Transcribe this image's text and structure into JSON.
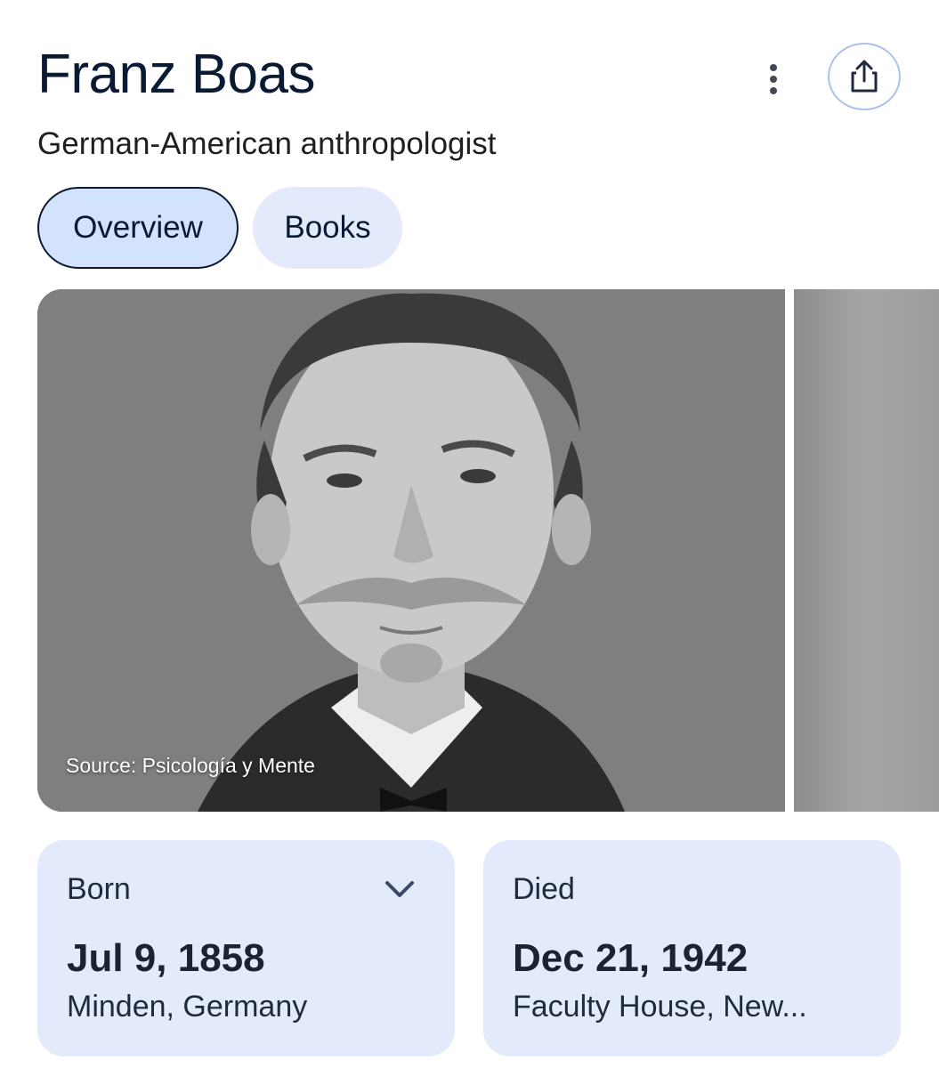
{
  "header": {
    "title": "Franz Boas",
    "subtitle": "German-American anthropologist",
    "more_icon": "more-vert-icon",
    "share_icon": "share-icon"
  },
  "tabs": [
    {
      "label": "Overview",
      "selected": true
    },
    {
      "label": "Books",
      "selected": false
    }
  ],
  "gallery": {
    "main_image": "portrait-photo",
    "source_label": "Source: Psicología y Mente"
  },
  "facts": {
    "born": {
      "label": "Born",
      "date": "Jul 9, 1858",
      "place": "Minden, Germany"
    },
    "died": {
      "label": "Died",
      "date": "Dec 21, 1942",
      "place": "Faculty House, New..."
    }
  },
  "colors": {
    "accent": "#d3e3fd",
    "card": "#e3eafc",
    "title": "#0b1a33"
  }
}
